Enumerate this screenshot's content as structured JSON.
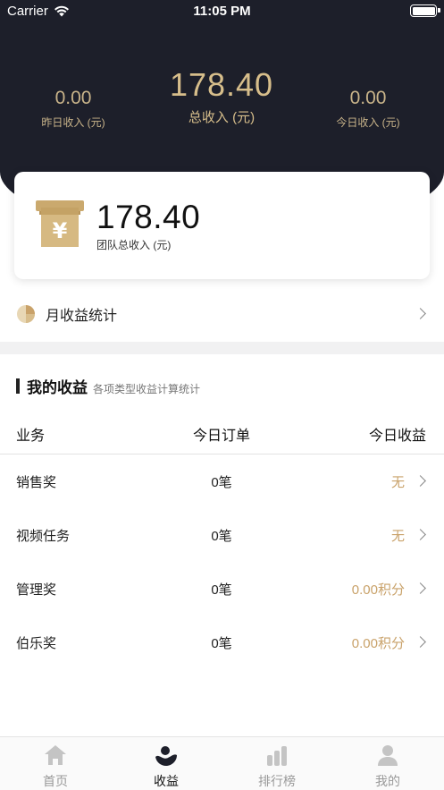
{
  "status_bar": {
    "carrier": "Carrier",
    "time": "11:05 PM"
  },
  "summary": {
    "yesterday": {
      "value": "0.00",
      "label": "昨日收入 (元)"
    },
    "total": {
      "value": "178.40",
      "label": "总收入 (元)"
    },
    "today": {
      "value": "0.00",
      "label": "今日收入 (元)"
    }
  },
  "team_card": {
    "amount": "178.40",
    "label": "团队总收入 (元)",
    "icon": "yen-register-icon"
  },
  "month_stats": {
    "label": "月收益统计",
    "icon": "pie-chart-icon"
  },
  "earnings": {
    "title": "我的收益",
    "subtitle": "各项类型收益计算统计",
    "headers": {
      "business": "业务",
      "today_orders": "今日订单",
      "today_income": "今日收益"
    },
    "rows": [
      {
        "business": "销售奖",
        "orders": "0笔",
        "income": "无"
      },
      {
        "business": "视频任务",
        "orders": "0笔",
        "income": "无"
      },
      {
        "business": "管理奖",
        "orders": "0笔",
        "income": "0.00积分"
      },
      {
        "business": "伯乐奖",
        "orders": "0笔",
        "income": "0.00积分"
      }
    ]
  },
  "tabs": [
    {
      "label": "首页",
      "icon": "home-icon",
      "active": false
    },
    {
      "label": "收益",
      "icon": "earnings-icon",
      "active": true
    },
    {
      "label": "排行榜",
      "icon": "ranking-icon",
      "active": false
    },
    {
      "label": "我的",
      "icon": "profile-icon",
      "active": false
    }
  ],
  "colors": {
    "header_bg": "#1d1f2a",
    "gold": "#d7be8b",
    "income_gold": "#c9a26a"
  }
}
